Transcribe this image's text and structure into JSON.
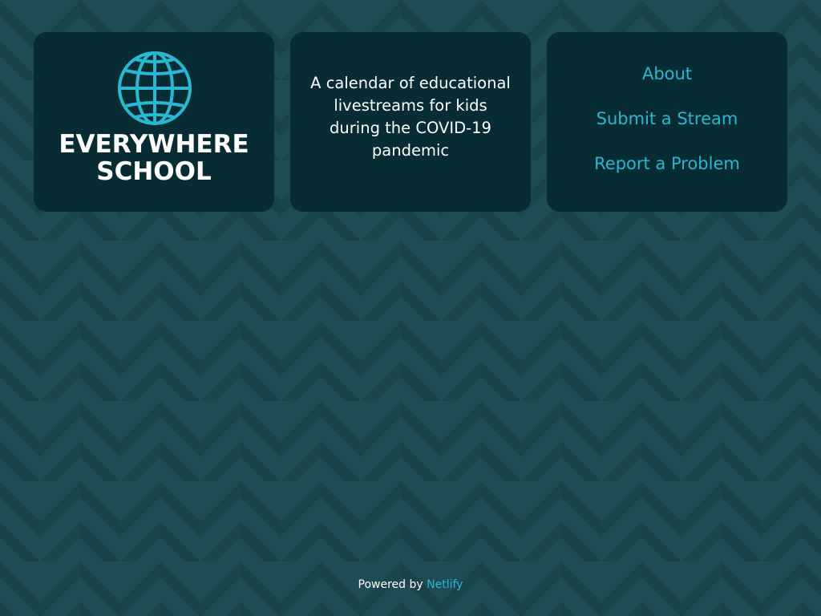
{
  "colors": {
    "background": "#1e4c54",
    "background_alt": "#1b444c",
    "card": "#082c34",
    "accent": "#29b7d1",
    "text": "#ffffff"
  },
  "logo": {
    "icon": "globe-icon",
    "line1": "EVERYWHERE",
    "line2": "SCHOOL"
  },
  "tagline": "A calendar of educational livestreams for kids during the COVID-19 pandemic",
  "nav": {
    "about": "About",
    "submit": "Submit a Stream",
    "report": "Report a Problem"
  },
  "footer": {
    "prefix": "Powered by ",
    "link": "Netlify"
  }
}
